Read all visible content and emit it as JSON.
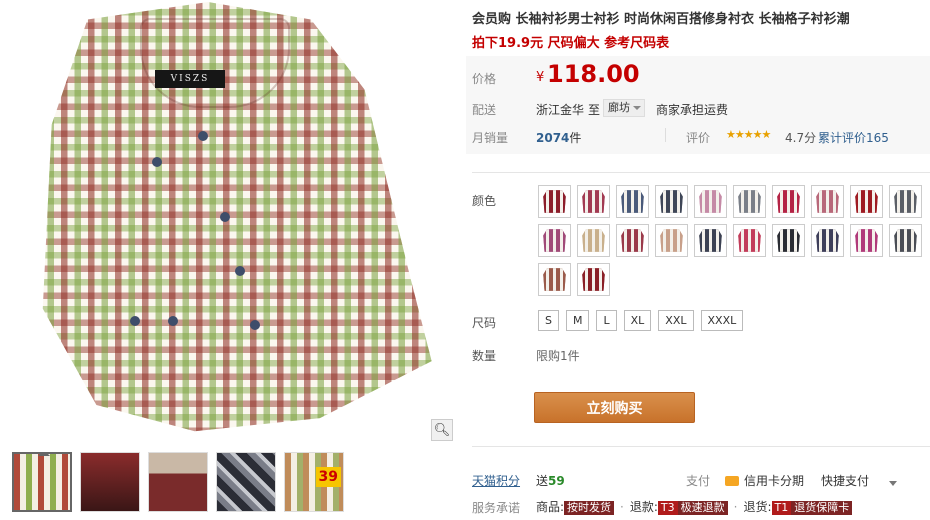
{
  "product": {
    "title": "会员购 长袖衬衫男士衬衫 时尚休闲百搭修身衬衣 长袖格子衬衫潮",
    "subtitle": "拍下19.9元 尺码偏大 参考尺码表",
    "brand_label": "VISZS"
  },
  "price": {
    "label": "价格",
    "currency": "¥",
    "value": "118.00"
  },
  "shipping": {
    "label": "配送",
    "from": "浙江金华",
    "to_word": "至",
    "city": "廊坊",
    "note": "商家承担运费"
  },
  "sales": {
    "label": "月销量",
    "count": "2074",
    "unit": "件",
    "rating_label": "评价",
    "stars": "★★★★★",
    "score": "4.7分",
    "total_reviews": "累计评价165"
  },
  "colors": {
    "label": "颜色",
    "swatches": [
      "#8c1d2a",
      "#a23a52",
      "#4a5a7a",
      "#3f4657",
      "#c58aa6",
      "#7a7f88",
      "#b42345",
      "#b8687a",
      "#9e1b22",
      "#5b5f67",
      "#a04a78",
      "#c9b08c",
      "#9a3a4a",
      "#c8a08a",
      "#3c4152",
      "#c23c5a",
      "#2a2c33",
      "#3e3f5a",
      "#b03a7a",
      "#4a4d55",
      "#9a5a4a",
      "#8a1f26"
    ]
  },
  "size": {
    "label": "尺码",
    "options": [
      "S",
      "M",
      "L",
      "XL",
      "XXL",
      "XXXL"
    ]
  },
  "quantity": {
    "label": "数量",
    "limit": "限购1件"
  },
  "buy_button": "立刻购买",
  "points": {
    "label": "天猫积分",
    "value_prefix": "送",
    "value": "59"
  },
  "payment": {
    "label": "支付",
    "credit": "信用卡分期",
    "quick": "快捷支付"
  },
  "service": {
    "label": "服务承诺",
    "goods_label": "商品:",
    "goods_tag": "按时发货",
    "refund_label": "退款:",
    "refund_code": "T3",
    "refund_tag": "极速退款",
    "return_label": "退货:",
    "return_code": "T1",
    "return_tag": "退货保障卡"
  },
  "thumbnail_badge": "39"
}
